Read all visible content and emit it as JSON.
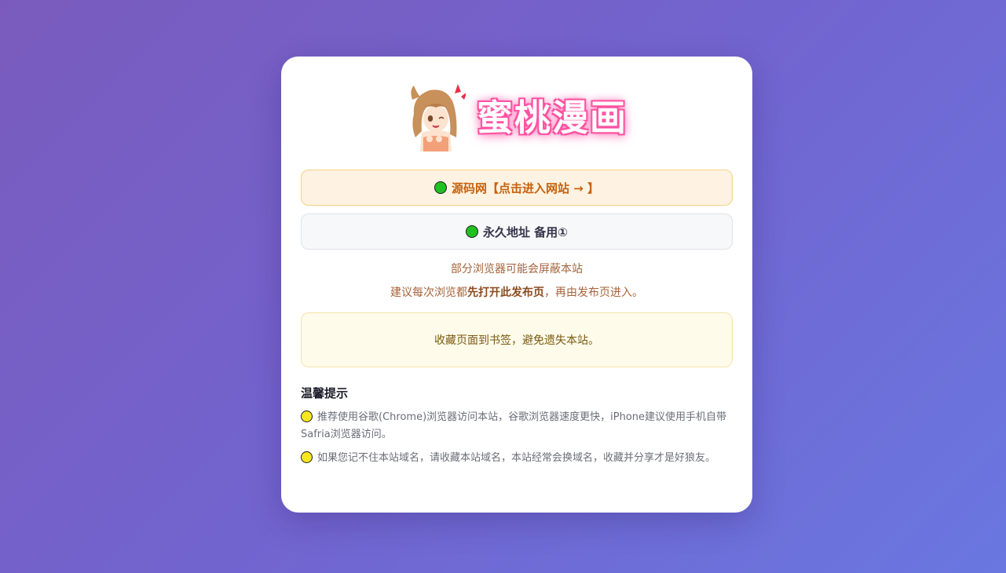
{
  "site": {
    "logo_text": "蜜桃漫画"
  },
  "links": {
    "primary_label": "源码网【点击进入网站 → 】",
    "secondary_label": "永久地址 备用①"
  },
  "warning": {
    "line1": "部分浏览器可能会屏蔽本站",
    "line2_prefix": "建议每次浏览都",
    "line2_bold": "先打开此发布页",
    "line2_suffix": "，再由发布页进入。"
  },
  "notice": {
    "text": "收藏页面到书签，避免遗失本站。"
  },
  "tips": {
    "title": "温馨提示",
    "items": [
      "推荐使用谷歌(Chrome)浏览器访问本站，谷歌浏览器速度更快，iPhone建议使用手机自带Safria浏览器访问。",
      "如果您记不住本站域名，请收藏本站域名，本站经常会换域名，收藏并分享才是好狼友。"
    ]
  },
  "colors": {
    "status_dot_link": "#20c020",
    "status_dot_tip": "#f8e61e",
    "primary_link_text": "#c7610c"
  }
}
